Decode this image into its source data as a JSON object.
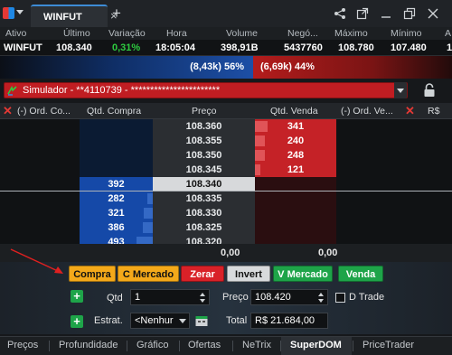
{
  "tabs": {
    "active": "WINFUT",
    "close_glyph": "×",
    "add_glyph": "+"
  },
  "toolbar_icons": [
    "share-icon",
    "external-window-icon",
    "minimize-icon",
    "restore-icon",
    "close-icon"
  ],
  "quote": {
    "headers": [
      "Ativo",
      "Último",
      "Variação",
      "Hora",
      "Volume",
      "Negó...",
      "Máximo",
      "Mínimo",
      "A"
    ],
    "values": [
      "WINFUT",
      "108.340",
      "0,31%",
      "18:05:04",
      "398,91B",
      "5437760",
      "108.780",
      "107.480",
      "1"
    ]
  },
  "balance": {
    "buy_text": "(8,43k) 56%",
    "sell_text": "(6,69k) 44%",
    "buy_fraction": 0.56
  },
  "account": {
    "label": "Simulador - **4110739 - ***********************"
  },
  "dom": {
    "headers": {
      "ord_compra": "(-) Ord. Co...",
      "qtd_compra": "Qtd. Compra",
      "preco": "Preço",
      "qtd_venda": "Qtd. Venda",
      "ord_venda": "(-) Ord. Ve...",
      "rs": "R$"
    },
    "sell_rows": [
      {
        "price": "108.360",
        "qty": "341",
        "depth": 0.15
      },
      {
        "price": "108.355",
        "qty": "240",
        "depth": 0.12
      },
      {
        "price": "108.350",
        "qty": "248",
        "depth": 0.12
      },
      {
        "price": "108.345",
        "qty": "121",
        "depth": 0.07
      }
    ],
    "buy_rows": [
      {
        "price": "108.340",
        "qty": "392",
        "depth": 0.0,
        "last": true
      },
      {
        "price": "108.335",
        "qty": "282",
        "depth": 0.08
      },
      {
        "price": "108.330",
        "qty": "321",
        "depth": 0.12
      },
      {
        "price": "108.325",
        "qty": "386",
        "depth": 0.14
      },
      {
        "price": "108.320",
        "qty": "493",
        "depth": 0.22
      }
    ],
    "totals": {
      "buy": "0,00",
      "sell": "0,00"
    }
  },
  "order": {
    "buttons": {
      "compra": "Compra",
      "c_mercado": "C Mercado",
      "zerar": "Zerar",
      "invert": "Invert",
      "v_mercado": "V Mercado",
      "venda": "Venda"
    },
    "qtd_label": "Qtd",
    "qtd_value": "1",
    "preco_label": "Preço",
    "preco_value": "108.420",
    "dtrade_label": "D Trade",
    "estrat_label": "Estrat.",
    "estrat_value": "<Nenhur",
    "total_label": "Total",
    "total_value": "R$ 21.684,00"
  },
  "bottom_tabs": [
    "Preços",
    "Profundidade",
    "Gráfico",
    "Ofertas",
    "NeTrix",
    "SuperDOM",
    "PriceTrader"
  ],
  "bottom_tabs_active": "SuperDOM",
  "colors": {
    "buy": "#1549a8",
    "sell": "#c52227",
    "accent": "#f4a91a",
    "green": "#1ea449"
  }
}
